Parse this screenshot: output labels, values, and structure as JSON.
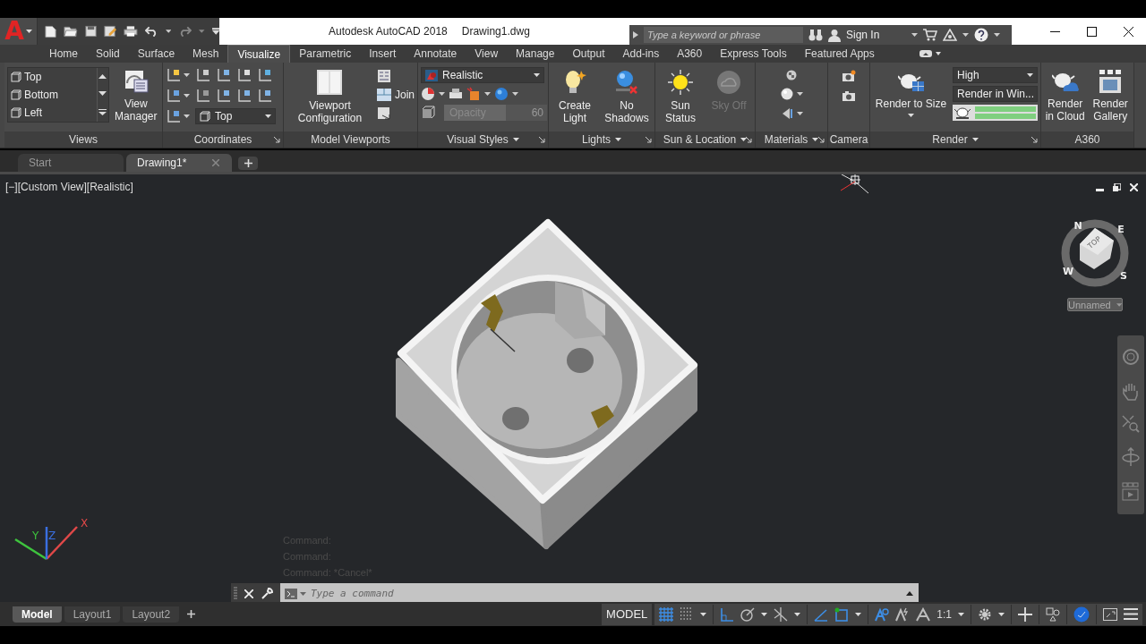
{
  "app_button": {
    "letter": "A"
  },
  "title": {
    "app": "Autodesk AutoCAD 2018",
    "file": "Drawing1.dwg"
  },
  "search": {
    "placeholder": "Type a keyword or phrase"
  },
  "account": {
    "label": "Sign In"
  },
  "ribbon_tabs": [
    {
      "label": "Home",
      "selected": false
    },
    {
      "label": "Solid",
      "selected": false
    },
    {
      "label": "Surface",
      "selected": false
    },
    {
      "label": "Mesh",
      "selected": false
    },
    {
      "label": "Visualize",
      "selected": true
    },
    {
      "label": "Parametric",
      "selected": false
    },
    {
      "label": "Insert",
      "selected": false
    },
    {
      "label": "Annotate",
      "selected": false
    },
    {
      "label": "View",
      "selected": false
    },
    {
      "label": "Manage",
      "selected": false
    },
    {
      "label": "Output",
      "selected": false
    },
    {
      "label": "Add-ins",
      "selected": false
    },
    {
      "label": "A360",
      "selected": false
    },
    {
      "label": "Express Tools",
      "selected": false
    },
    {
      "label": "Featured Apps",
      "selected": false
    }
  ],
  "panels": [
    {
      "kind": "views",
      "label": "Views",
      "menu": false,
      "launcher": false,
      "views": [
        "Top",
        "Bottom",
        "Left"
      ],
      "button": "View Manager"
    },
    {
      "kind": "coordinates",
      "label": "Coordinates",
      "menu": false,
      "launcher": true,
      "dropdown": "Top"
    },
    {
      "kind": "viewports",
      "label": "Model Viewports",
      "menu": false,
      "launcher": false,
      "button": "Viewport Configuration",
      "join": "Join"
    },
    {
      "kind": "visual_styles",
      "label": "Visual Styles",
      "menu": true,
      "launcher": true,
      "style": "Realistic",
      "opacity_label": "Opacity",
      "opacity_value": "60",
      "level": 0.6
    },
    {
      "kind": "lights",
      "label": "Lights",
      "menu": true,
      "launcher": true,
      "buttons": [
        "Create Light",
        "No Shadows"
      ]
    },
    {
      "kind": "sun",
      "label": "Sun & Location",
      "menu": true,
      "launcher": true,
      "buttons": [
        {
          "label": "Sun Status",
          "disabled": false
        },
        {
          "label": "Sky Off",
          "disabled": true
        }
      ]
    },
    {
      "kind": "materials",
      "label": "Materials",
      "menu": true,
      "launcher": true
    },
    {
      "kind": "camera",
      "label": "Camera",
      "menu": false,
      "launcher": false
    },
    {
      "kind": "render",
      "label": "Render",
      "menu": true,
      "launcher": true,
      "button": "Render to Size",
      "quality": "High",
      "target": "Render in Win...",
      "level": 1
    },
    {
      "kind": "a360",
      "label": "A360",
      "menu": false,
      "launcher": false,
      "buttons": [
        "Render in Cloud",
        "Render Gallery"
      ]
    }
  ],
  "file_tabs": [
    {
      "label": "Start",
      "selected": false,
      "closable": false
    },
    {
      "label": "Drawing1*",
      "selected": true,
      "closable": true
    }
  ],
  "viewport": {
    "label": "[−][Custom View][Realistic]",
    "viewcube_face": "TOP",
    "compass": [
      "N",
      "E",
      "W",
      "S"
    ],
    "ucs_menu": "Unnamed",
    "ucs_axes": [
      "X",
      "Y",
      "Z"
    ]
  },
  "command_history": [
    "Command:",
    "Command:",
    "Command: *Cancel*"
  ],
  "command_line": {
    "placeholder": "Type a command"
  },
  "layout_tabs": [
    {
      "label": "Model",
      "selected": true
    },
    {
      "label": "Layout1",
      "selected": false
    },
    {
      "label": "Layout2",
      "selected": false
    }
  ],
  "status_bar": {
    "mode": "MODEL",
    "scale": "1:1",
    "toggles": [
      {
        "kind": "grid",
        "on": true
      },
      {
        "kind": "snap",
        "on": false
      },
      {
        "kind": "ortho",
        "on": true
      },
      {
        "kind": "polar",
        "on": false
      },
      {
        "kind": "isodraft",
        "on": false
      },
      {
        "kind": "tracking",
        "on": true
      },
      {
        "kind": "osnap",
        "on": true
      },
      {
        "kind": "annotation",
        "on": true
      },
      {
        "kind": "autoscale",
        "on": false
      },
      {
        "kind": "annoscale",
        "on": false
      }
    ]
  }
}
